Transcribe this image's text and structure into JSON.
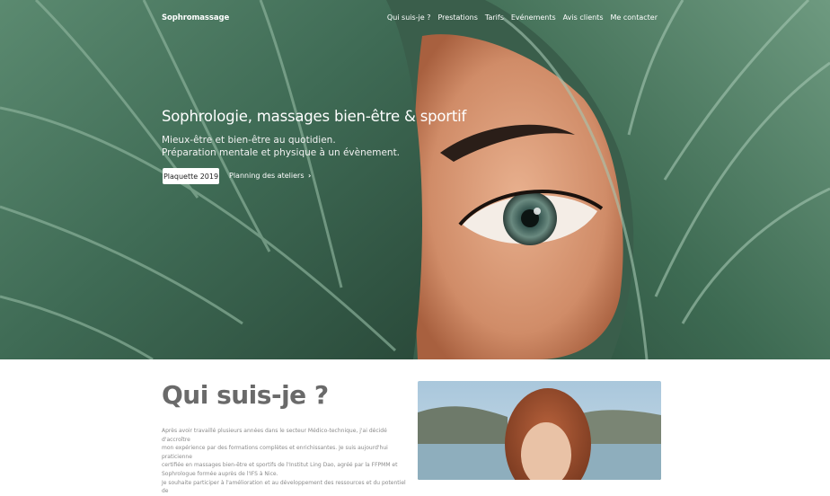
{
  "nav": {
    "brand": "Sophromassage",
    "links": [
      "Qui suis-je ?",
      "Prestations",
      "Tarifs",
      "Evénements",
      "Avis clients",
      "Me contacter"
    ]
  },
  "hero": {
    "title": "Sophrologie, massages bien-être & sportif",
    "subtitle_line1": "Mieux-être et bien-être au quotidien.",
    "subtitle_line2": "Préparation mentale et physique à un évènement.",
    "primary_button": "Plaquette 2019",
    "secondary_link": "Planning des ateliers",
    "secondary_icon": "chevron-right-icon"
  },
  "about": {
    "title": "Qui suis-je ?",
    "paragraph_line1": "Après avoir travaillé plusieurs années dans le secteur Médico-technique, j'ai décidé d'accroître",
    "paragraph_line2": "mon expérience par des formations complètes et enrichissantes. Je suis aujourd'hui praticienne",
    "paragraph_line3": "certifiée en massages bien-être et sportifs de l'Institut Ling Dao, agréé par la FFPMM et",
    "paragraph_line4": "Sophrologue formée auprès de l'IFS à Nice.",
    "paragraph_line5": "Je souhaite participer à l'amélioration et au développement des ressources et du potentiel de"
  },
  "colors": {
    "leaf_dark": "#2d4a3d",
    "leaf_mid": "#4f7a63",
    "skin": "#d89a78",
    "title_gray": "#6a6a6a"
  }
}
